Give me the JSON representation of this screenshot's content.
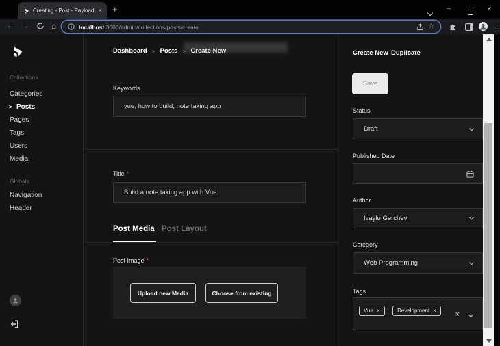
{
  "browser": {
    "tab_title": "Creating - Post - Payload",
    "url": {
      "host": "localhost",
      "path": ":3000/admin/collections/posts/create"
    },
    "glyphs": {
      "tab_close": "×",
      "new_tab": "+",
      "back": "←",
      "forward": "→",
      "home": "⌂",
      "star": "☆",
      "kebab": "⋮",
      "minimize": "–",
      "window_close": "×"
    }
  },
  "sidebar": {
    "collections_label": "Collections",
    "collections": [
      {
        "label": "Categories"
      },
      {
        "label": "Posts",
        "chevron": ">"
      },
      {
        "label": "Pages"
      },
      {
        "label": "Tags"
      },
      {
        "label": "Users"
      },
      {
        "label": "Media"
      }
    ],
    "globals_label": "Globals",
    "globals": [
      {
        "label": "Navigation"
      },
      {
        "label": "Header"
      }
    ]
  },
  "main": {
    "breadcrumb": {
      "items": [
        "Dashboard",
        "Posts",
        "Create New"
      ],
      "separator": ">"
    },
    "keywords": {
      "label": "Keywords",
      "value": "vue, how to build, note taking app"
    },
    "title_field": {
      "label": "Title",
      "required_mark": "*",
      "value": "Build a note taking app with Vue"
    },
    "tabs": [
      {
        "label": "Post Media"
      },
      {
        "label": "Post Layout"
      }
    ],
    "post_image": {
      "label": "Post Image",
      "required_mark": "*",
      "upload_button": "Upload new Media",
      "choose_button": "Choose from existing"
    }
  },
  "panel": {
    "create_new": "Create New",
    "duplicate": "Duplicate",
    "save": "Save",
    "status": {
      "label": "Status",
      "value": "Draft"
    },
    "published_date": {
      "label": "Published Date",
      "value": ""
    },
    "author": {
      "label": "Author",
      "value": "Ivaylo Gerchev"
    },
    "category": {
      "label": "Category",
      "value": "Web Programming"
    },
    "tags": {
      "label": "Tags",
      "chips": [
        {
          "label": "Vue"
        },
        {
          "label": "Development"
        }
      ],
      "remove_glyph": "×"
    }
  },
  "colors": {
    "page_bg": "#141414",
    "field_bg": "#1c1c1c",
    "field_border": "#373737",
    "focus_ring": "#5d79c4",
    "save_bg": "#ebebeb",
    "required": "#d64545",
    "scroll_thumb": "#b3b3b3"
  }
}
